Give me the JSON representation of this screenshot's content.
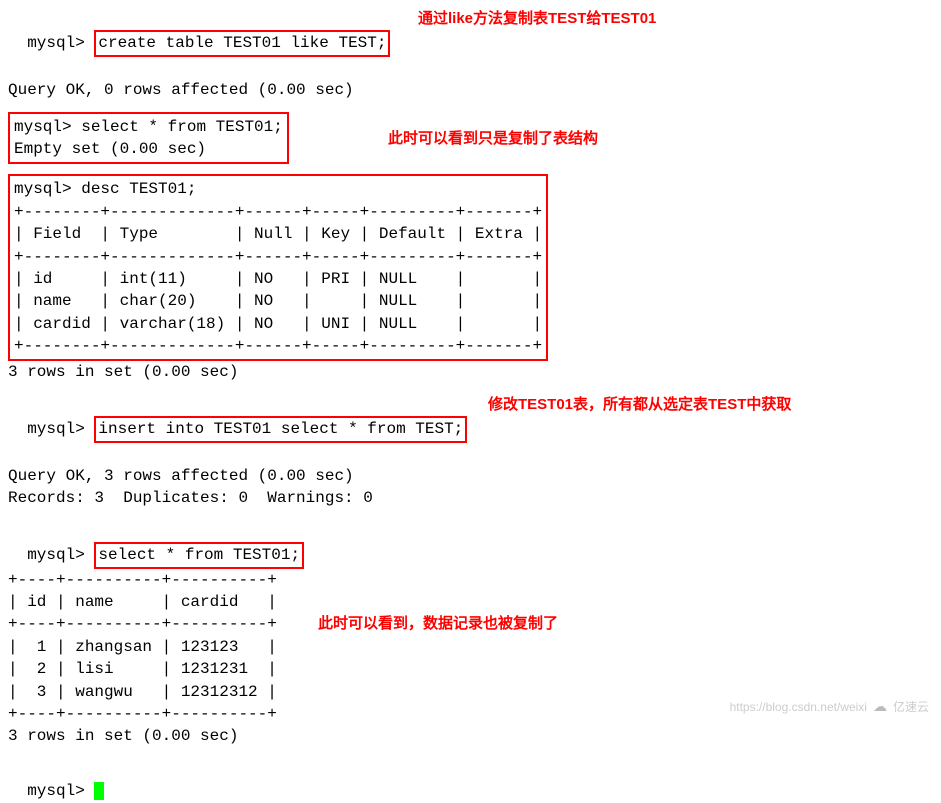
{
  "prompt": "mysql>",
  "cmd1": "create table TEST01 like TEST;",
  "res1": "Query OK, 0 rows affected (0.00 sec)",
  "anno1": "通过like方法复制表TEST给TEST01",
  "cmd2": "select * from TEST01;",
  "res2": "Empty set (0.00 sec)",
  "anno2": "此时可以看到只是复制了表结构",
  "cmd3": "desc TEST01;",
  "desc_border": "+--------+-------------+------+-----+---------+-------+",
  "desc_header": "| Field  | Type        | Null | Key | Default | Extra |",
  "desc_row1": "| id     | int(11)     | NO   | PRI | NULL    |       |",
  "desc_row2": "| name   | char(20)    | NO   |     | NULL    |       |",
  "desc_row3": "| cardid | varchar(18) | NO   | UNI | NULL    |       |",
  "res3": "3 rows in set (0.00 sec)",
  "cmd4": "insert into TEST01 select * from TEST;",
  "res4a": "Query OK, 3 rows affected (0.00 sec)",
  "res4b": "Records: 3  Duplicates: 0  Warnings: 0",
  "anno4": "修改TEST01表，所有都从选定表TEST中获取",
  "cmd5": "select * from TEST01;",
  "sel_border": "+----+----------+----------+",
  "sel_header": "| id | name     | cardid   |",
  "sel_row1": "|  1 | zhangsan | 123123   |",
  "sel_row2": "|  2 | lisi     | 1231231  |",
  "sel_row3": "|  3 | wangwu   | 12312312 |",
  "res5": "3 rows in set (0.00 sec)",
  "anno5": "此时可以看到，数据记录也被复制了",
  "watermark_url": "https://blog.csdn.net/weixi",
  "watermark_brand": "亿速云",
  "chart_data": {
    "type": "table",
    "tables": [
      {
        "title": "desc TEST01",
        "columns": [
          "Field",
          "Type",
          "Null",
          "Key",
          "Default",
          "Extra"
        ],
        "rows": [
          [
            "id",
            "int(11)",
            "NO",
            "PRI",
            "NULL",
            ""
          ],
          [
            "name",
            "char(20)",
            "NO",
            "",
            "NULL",
            ""
          ],
          [
            "cardid",
            "varchar(18)",
            "NO",
            "UNI",
            "NULL",
            ""
          ]
        ]
      },
      {
        "title": "select * from TEST01",
        "columns": [
          "id",
          "name",
          "cardid"
        ],
        "rows": [
          [
            "1",
            "zhangsan",
            "123123"
          ],
          [
            "2",
            "lisi",
            "1231231"
          ],
          [
            "3",
            "wangwu",
            "12312312"
          ]
        ]
      }
    ]
  }
}
